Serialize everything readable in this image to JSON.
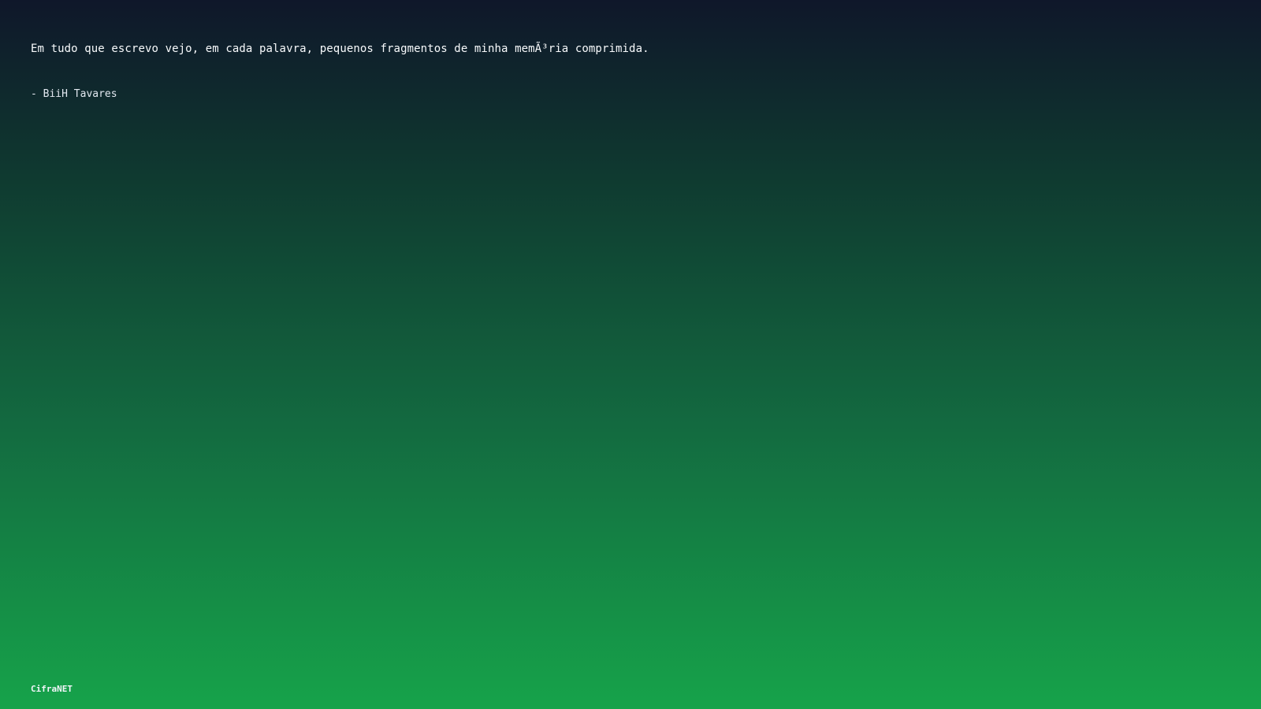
{
  "quote": {
    "text": "Em tudo que escrevo vejo, em cada palavra, pequenos fragmentos de minha memÃ³ria comprimida.",
    "author": "- BiiH Tavares"
  },
  "footer": {
    "brand": "CifraNET"
  },
  "colors": {
    "gradient_top": "#0f172a",
    "gradient_bottom": "#16a34a",
    "text": "#ffffff"
  }
}
